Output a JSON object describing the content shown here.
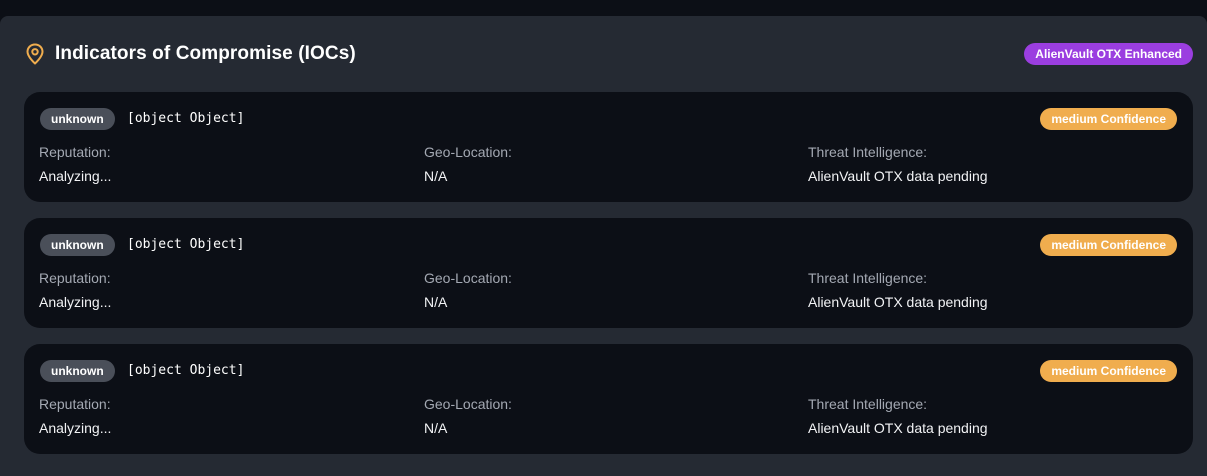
{
  "header": {
    "title": "Indicators of Compromise (IOCs)",
    "source_badge": "AlienVault OTX Enhanced",
    "icon": "map-pin-icon"
  },
  "colors": {
    "accent_pin": "#f0ad4e",
    "source_badge_bg": "#9b3ee0",
    "confidence_badge_bg": "#f0ad4e",
    "type_badge_bg": "#4a4f59"
  },
  "iocs": [
    {
      "type": "unknown",
      "value": "[object Object]",
      "confidence": "medium Confidence",
      "reputation_label": "Reputation:",
      "reputation_value": "Analyzing...",
      "geo_label": "Geo-Location:",
      "geo_value": "N/A",
      "threat_label": "Threat Intelligence:",
      "threat_value": "AlienVault OTX data pending"
    },
    {
      "type": "unknown",
      "value": "[object Object]",
      "confidence": "medium Confidence",
      "reputation_label": "Reputation:",
      "reputation_value": "Analyzing...",
      "geo_label": "Geo-Location:",
      "geo_value": "N/A",
      "threat_label": "Threat Intelligence:",
      "threat_value": "AlienVault OTX data pending"
    },
    {
      "type": "unknown",
      "value": "[object Object]",
      "confidence": "medium Confidence",
      "reputation_label": "Reputation:",
      "reputation_value": "Analyzing...",
      "geo_label": "Geo-Location:",
      "geo_value": "N/A",
      "threat_label": "Threat Intelligence:",
      "threat_value": "AlienVault OTX data pending"
    }
  ]
}
